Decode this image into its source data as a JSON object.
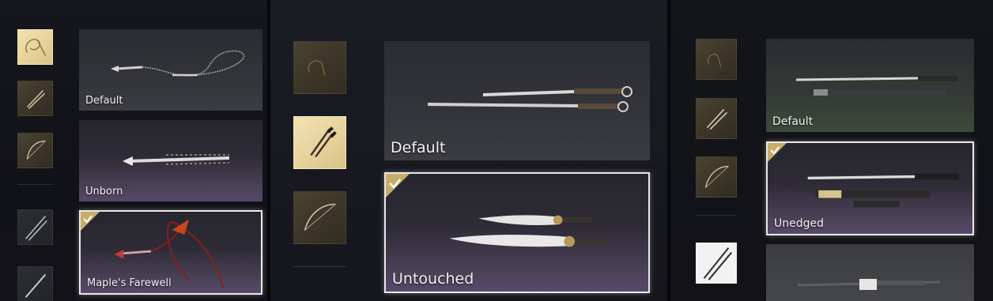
{
  "panels": [
    {
      "cards": [
        {
          "name": "Default"
        },
        {
          "name": "Unborn"
        },
        {
          "name": "Maple's Farewell",
          "selected": true
        }
      ]
    },
    {
      "cards": [
        {
          "name": "Default"
        },
        {
          "name": "Untouched",
          "selected": true
        }
      ]
    },
    {
      "cards": [
        {
          "name": "Default"
        },
        {
          "name": "Unedged",
          "selected": true
        },
        {
          "name": ""
        }
      ]
    }
  ]
}
